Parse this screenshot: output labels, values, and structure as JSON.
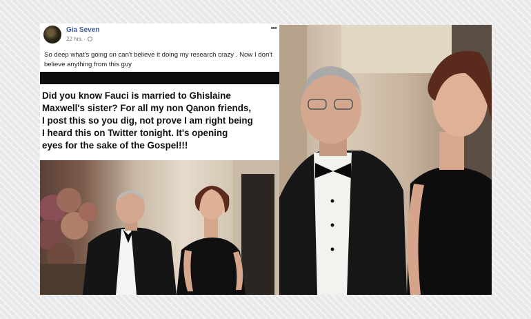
{
  "post": {
    "author": "Gia Seven",
    "timestamp": "22 hrs",
    "separator": "·",
    "more_glyph": "•••",
    "text": "So deep what's going on can't believe it doing my research crazy . Now I don't believe anything from this guy"
  },
  "meme": {
    "lines": [
      "Did you know Fauci is married to Ghislaine",
      "Maxwell's sister? For all my non Qanon friends,",
      "I post this so you dig, not prove I am right being",
      "I heard this on Twitter tonight.   It's opening",
      "eyes for the sake of the Gospel!!!"
    ]
  },
  "icons": {
    "globe": "globe-icon",
    "more": "more-options-icon"
  }
}
